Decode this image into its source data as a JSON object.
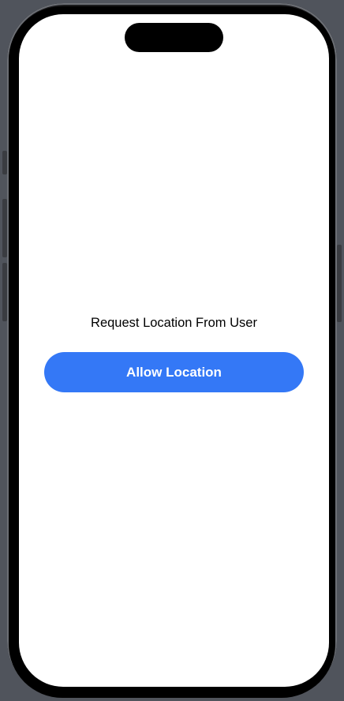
{
  "screen": {
    "prompt": "Request Location From User",
    "allow_button_label": "Allow Location"
  },
  "colors": {
    "accent": "#3478f6",
    "background": "#ffffff",
    "device_frame": "#50545c"
  }
}
